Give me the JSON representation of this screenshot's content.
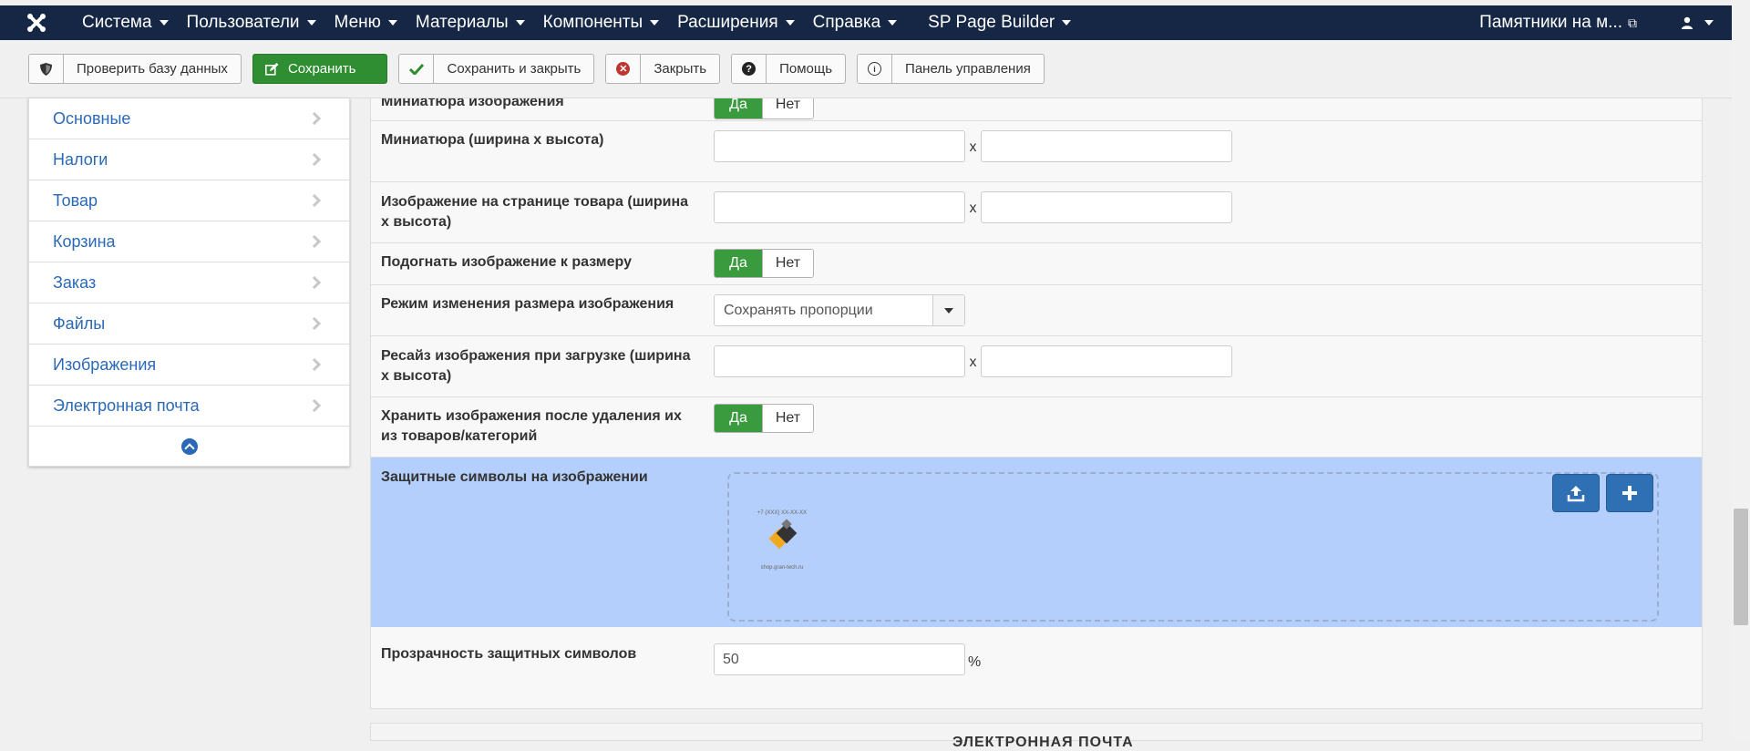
{
  "topnav": {
    "menus": [
      "Система",
      "Пользователи",
      "Меню",
      "Материалы",
      "Компоненты",
      "Расширения",
      "Справка",
      "SP Page Builder"
    ],
    "site_link": "Памятники на м...",
    "user_icon": "user-icon"
  },
  "toolbar": {
    "check_db": "Проверить базу данных",
    "save": "Сохранить",
    "save_close": "Сохранить и закрыть",
    "close": "Закрыть",
    "help": "Помощь",
    "control_panel": "Панель управления"
  },
  "sidebar": {
    "items": [
      "Основные",
      "Налоги",
      "Товар",
      "Корзина",
      "Заказ",
      "Файлы",
      "Изображения",
      "Электронная почта"
    ]
  },
  "form": {
    "thumb_top_label": "Миниатюра изображения",
    "yes": "Да",
    "no": "Нет",
    "x": "x",
    "thumb_size_label": "Миниатюра (ширина х высота)",
    "product_image_label": "Изображение на странице товара (ширина х высота)",
    "fit_image_label": "Подогнать изображение к размеру",
    "resize_mode_label": "Режим изменения размера изображения",
    "resize_mode_value": "Сохранять пропорции",
    "upload_resize_label": "Ресайз изображения при загрузке (ширина х высота)",
    "keep_images_label": "Хранить изображения после удаления их из товаров/категорий",
    "watermark_label": "Защитные символы на изображении",
    "watermark_logo_top": "+7 (XXX) XX-XX-XX",
    "watermark_logo_bottom": "shop.gran-tech.ru",
    "opacity_label": "Прозрачность защитных символов",
    "opacity_value": "50",
    "percent": "%",
    "next_section": "ЭЛЕКТРОННАЯ ПОЧТА"
  },
  "colors": {
    "nav_bg": "#152744",
    "save_green": "#2f8e31",
    "link_blue": "#2a69b8",
    "highlight": "#b4cffb"
  }
}
